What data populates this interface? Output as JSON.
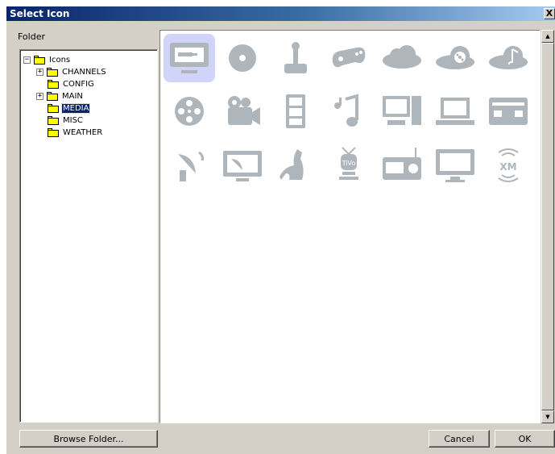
{
  "window": {
    "title": "Select Icon",
    "close_glyph": "X"
  },
  "folder_label": "Folder",
  "tree": [
    {
      "label": "Icons",
      "expander": "−",
      "selected": false
    },
    {
      "label": "CHANNELS",
      "expander": "+",
      "selected": false
    },
    {
      "label": "CONFIG",
      "expander": "",
      "selected": false
    },
    {
      "label": "MAIN",
      "expander": "+",
      "selected": false
    },
    {
      "label": "MEDIA",
      "expander": "",
      "selected": true
    },
    {
      "label": "MISC",
      "expander": "",
      "selected": false
    },
    {
      "label": "WEATHER",
      "expander": "",
      "selected": false
    }
  ],
  "icons": [
    "monitor-plug-icon",
    "disc-icon",
    "joystick-icon",
    "gamepad-icon",
    "cloud-icon",
    "cloud-film-icon",
    "cloud-music-icon",
    "film-reel-icon",
    "movie-camera-icon",
    "filmstrip-icon",
    "music-notes-icon",
    "desktop-computer-icon",
    "laptop-icon",
    "cassette-icon",
    "satellite-dish-icon",
    "satellite-tv-icon",
    "kangaroo-icon",
    "tivo-icon",
    "radio-icon",
    "tv-screen-icon",
    "xm-radio-icon"
  ],
  "icon_color": "#aeb6bc",
  "selected_icon_index": 0,
  "buttons": {
    "browse": "Browse Folder...",
    "cancel": "Cancel",
    "ok": "OK"
  },
  "scrollbar": {
    "up": "▲",
    "down": "▼"
  }
}
